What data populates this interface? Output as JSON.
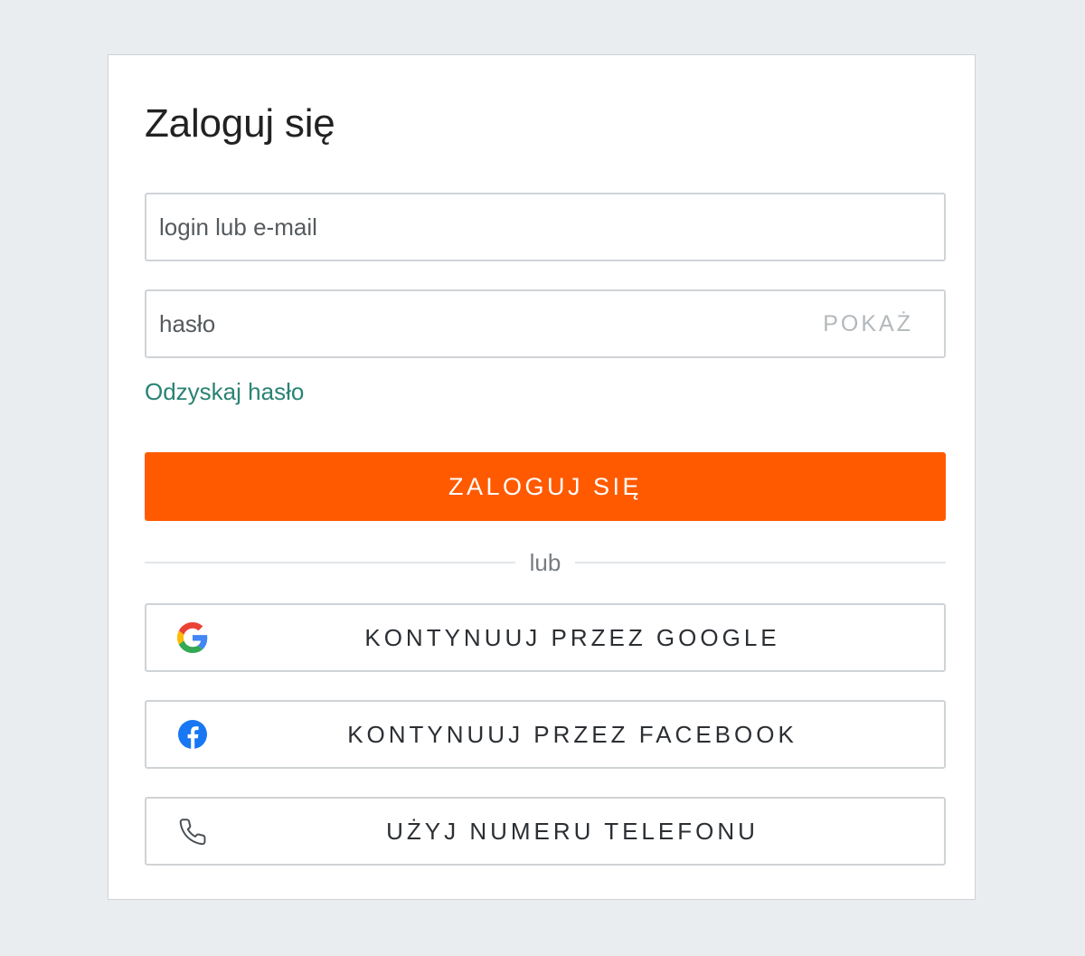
{
  "page": {
    "title": "Zaloguj się"
  },
  "form": {
    "login_placeholder": "login lub e-mail",
    "login_value": "",
    "password_placeholder": "hasło",
    "password_value": "",
    "show_password_label": "POKAŻ",
    "recover_link": "Odzyskaj hasło",
    "submit_label": "ZALOGUJ SIĘ"
  },
  "divider": {
    "label": "lub"
  },
  "social": {
    "google_label": "KONTYNUUJ PRZEZ GOOGLE",
    "facebook_label": "KONTYNUUJ PRZEZ FACEBOOK",
    "phone_label": "UŻYJ NUMERU TELEFONU"
  },
  "icons": {
    "google": "google-icon",
    "facebook": "facebook-icon",
    "phone": "phone-icon"
  },
  "colors": {
    "accent": "#ff5a00",
    "link": "#2a8374",
    "facebook": "#1877f2"
  }
}
